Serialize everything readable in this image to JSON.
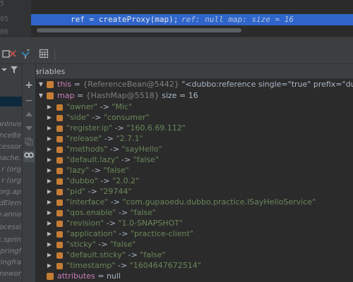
{
  "editor": {
    "gutter_lines": [
      "5",
      "05",
      "06"
    ],
    "code": {
      "statement": "ref = createProxy(map);",
      "inline_hint": "ref: null  map:  size = 16"
    }
  },
  "panel": {
    "variables_title": "Variables"
  },
  "frames": [
    "anInvo",
    "renceBe",
    "cessor",
    "pache.",
    "r (org",
    "r (org",
    "org.ap",
    "ldElem",
    "y.anno",
    "ocessi",
    "k.sprin",
    "springf",
    "ringfra",
    "mewor"
  ],
  "variables": {
    "this": {
      "name": "this",
      "type": "{ReferenceBean@5442}",
      "value": "\"<dubbo:reference single=\"true\" prefix=\"dubbo.reference.co"
    },
    "map": {
      "name": "map",
      "type": "{HashMap@5518}",
      "size": "size = 16"
    },
    "entries": [
      {
        "key": "\"owner\"",
        "value": "\"Mic\""
      },
      {
        "key": "\"side\"",
        "value": "\"consumer\""
      },
      {
        "key": "\"register.ip\"",
        "value": "\"160.6.69.112\""
      },
      {
        "key": "\"release\"",
        "value": "\"2.7.1\""
      },
      {
        "key": "\"methods\"",
        "value": "\"sayHello\""
      },
      {
        "key": "\"default.lazy\"",
        "value": "\"false\""
      },
      {
        "key": "\"lazy\"",
        "value": "\"false\""
      },
      {
        "key": "\"dubbo\"",
        "value": "\"2.0.2\""
      },
      {
        "key": "\"pid\"",
        "value": "\"29744\""
      },
      {
        "key": "\"interface\"",
        "value": "\"com.gupaoedu.dubbo.practice.ISayHelloService\""
      },
      {
        "key": "\"qos.enable\"",
        "value": "\"false\""
      },
      {
        "key": "\"revision\"",
        "value": "\"1.0-SNAPSHOT\""
      },
      {
        "key": "\"application\"",
        "value": "\"practice-client\""
      },
      {
        "key": "\"sticky\"",
        "value": "\"false\""
      },
      {
        "key": "\"default.sticky\"",
        "value": "\"false\""
      },
      {
        "key": "\"timestamp\"",
        "value": "\"1604647672514\""
      }
    ],
    "attributes": {
      "name": "attributes",
      "value": "null"
    },
    "arrow": "->",
    "equals": "="
  },
  "icons": {
    "toolbar": [
      "restore-layout-icon",
      "stop-icon",
      "step-over-icon",
      "evaluate-icon"
    ],
    "side": [
      "add-watch-icon",
      "remove-watch-icon",
      "move-up-icon",
      "move-down-icon",
      "copy-icon",
      "show-watches-icon"
    ],
    "frames": [
      "filter-icon",
      "dropdown-icon"
    ]
  },
  "colors": {
    "background": "#2b2b2b",
    "panel": "#3c3f41",
    "selection": "#2f65ca",
    "field_name": "#c77dbb",
    "string_value": "#6a8759",
    "field_icon": "#c57d36"
  }
}
